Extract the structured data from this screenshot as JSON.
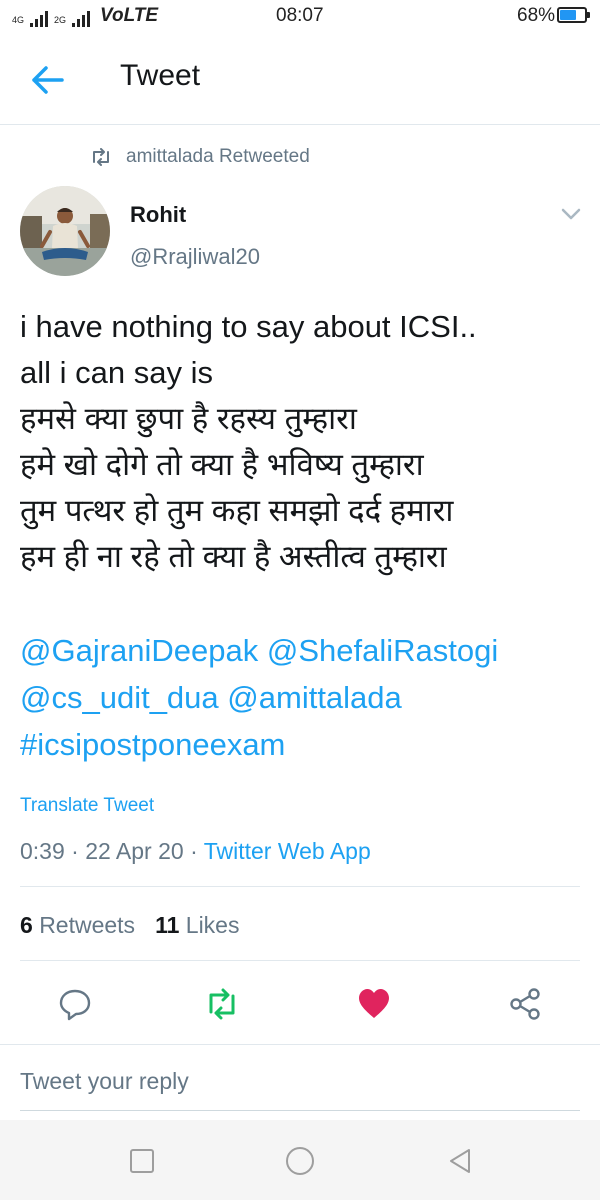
{
  "status_bar": {
    "network_small_top": "4G",
    "network_small_bottom": "2G",
    "volte": "VoLTE",
    "time": "08:07",
    "battery": "68%",
    "battery_level": 0.68
  },
  "header": {
    "title": "Tweet"
  },
  "retweet_context": {
    "text": "amittalada Retweeted"
  },
  "author": {
    "name": "Rohit",
    "handle": "@Rrajliwal20"
  },
  "tweet": {
    "lines": [
      "i have nothing to say about ICSI..",
      "all i can say is",
      "हमसे क्या छुपा है रहस्य तुम्हारा",
      "हमे खो दोगे तो क्या है भविष्य तुम्हारा",
      "तुम पत्थर हो तुम कहा समझो दर्द हमारा",
      "हम ही ना रहे तो क्या है अस्तीत्व तुम्हारा"
    ],
    "mentions": [
      "@GajraniDeepak",
      "@ShefaliRastogi",
      "@cs_udit_dua",
      "@amittalada"
    ],
    "hashtag": "#icsipostponeexam",
    "translate_label": "Translate Tweet",
    "time": "0:39",
    "separator": " · ",
    "date": "22 Apr 20",
    "source": "Twitter Web App"
  },
  "stats": {
    "retweets_count": "6",
    "retweets_label": "Retweets",
    "likes_count": "11",
    "likes_label": "Likes"
  },
  "reply": {
    "placeholder": "Tweet your reply"
  },
  "colors": {
    "link": "#1da1f2",
    "retweet_active": "#17bf63",
    "like_active": "#e0245e",
    "secondary_text": "#657786"
  }
}
